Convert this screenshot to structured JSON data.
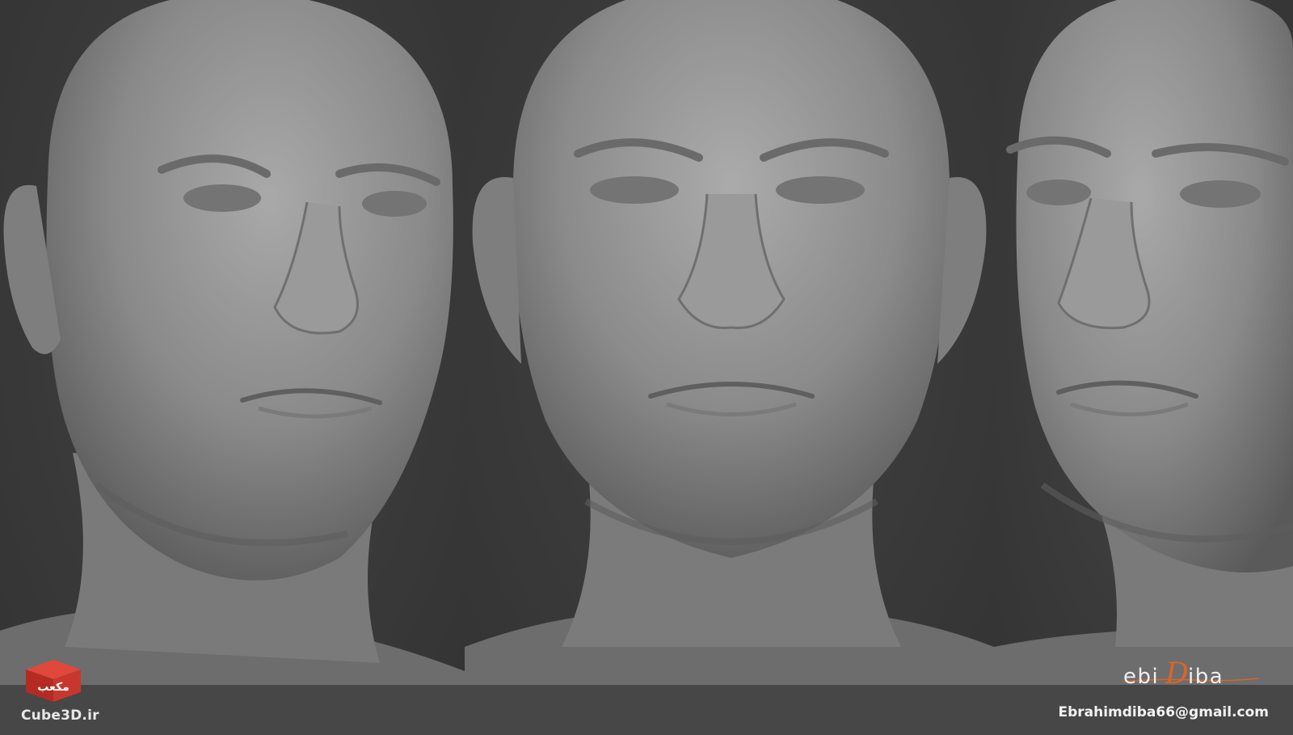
{
  "image": {
    "panels": [
      {
        "view": "three-quarter-left"
      },
      {
        "view": "front"
      },
      {
        "view": "three-quarter-right"
      }
    ]
  },
  "watermark": {
    "site_logo_label": "Cube3D.ir",
    "site_logo_glyph": "مکعب"
  },
  "artist": {
    "signature_prefix": "ebi",
    "signature_initial": "D",
    "signature_suffix": "iba",
    "email": "Ebrahimdiba66@gmail.com"
  },
  "colors": {
    "background": "#3a3a3a",
    "sculpt_clay": "#8f8f8f",
    "logo_red": "#c8372d",
    "signature_accent": "#d9652b"
  }
}
